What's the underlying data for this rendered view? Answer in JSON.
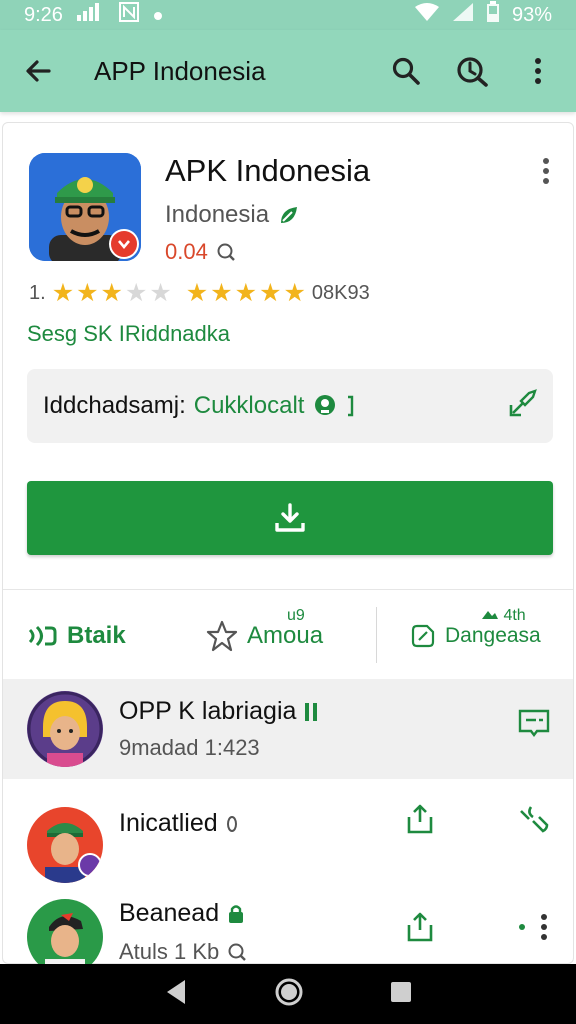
{
  "status_bar": {
    "time": "9:26",
    "battery": "93%"
  },
  "app_bar": {
    "title": "APP Indonesia"
  },
  "app": {
    "name": "APK Indonesia",
    "developer": "Indonesia",
    "version": "0.04",
    "rating_left": "1.",
    "rating_right": "08K93",
    "rating_left_stars": 3,
    "rating_right_stars": 5,
    "publisher": "Sesg SK IRiddnadka"
  },
  "info_box": {
    "label": "Iddchadsamj:",
    "value": "Cukklocalt"
  },
  "tabs": [
    {
      "label": "Btaik"
    },
    {
      "label": "Amoua",
      "superscript": "u9"
    },
    {
      "label": "Dangeasa",
      "superscript": "4th"
    }
  ],
  "list": [
    {
      "name": "OPP K labriagia",
      "sub": "9madad 1:423"
    },
    {
      "name": "Inicatlied",
      "sub": ""
    },
    {
      "name": "Beanead",
      "sub": "Atuls 1 Kb"
    }
  ],
  "colors": {
    "accent_green": "#1e8a3f",
    "appbar": "#92d7bb",
    "install": "#1f963e",
    "star": "#f2b41c"
  }
}
